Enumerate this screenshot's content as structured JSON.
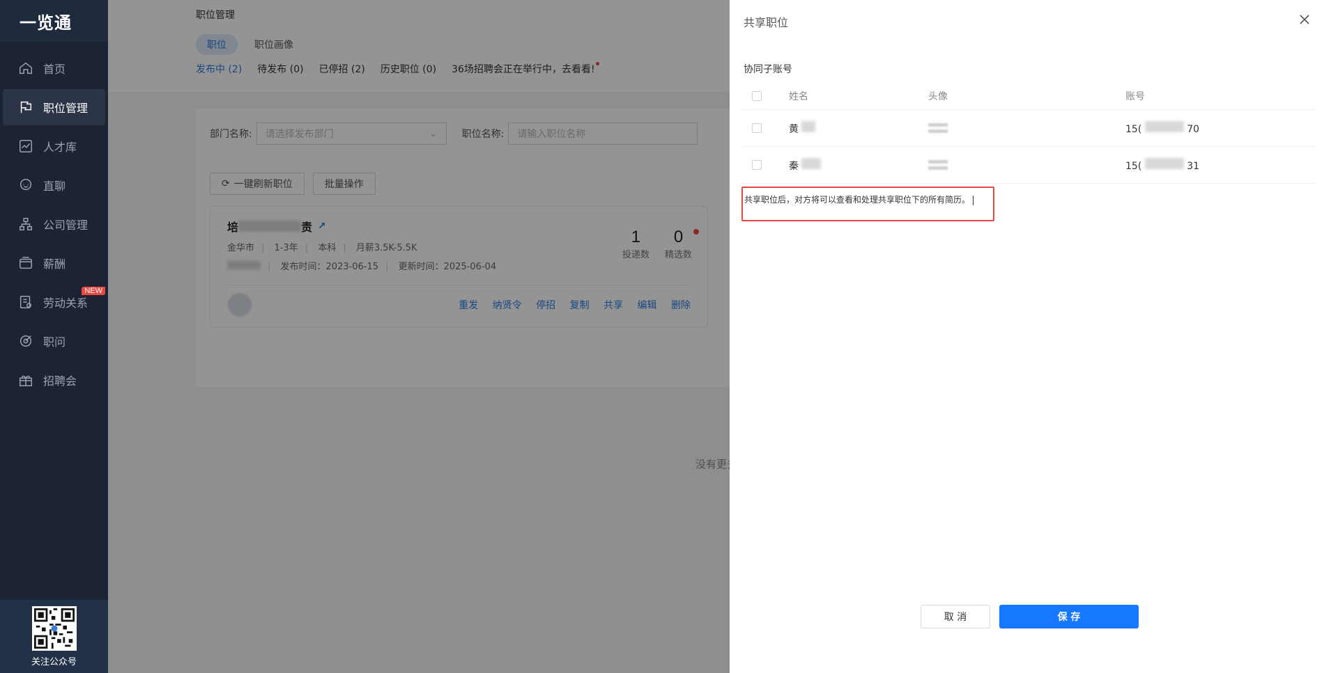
{
  "app": {
    "logo": "一览通"
  },
  "sidebar": {
    "items": [
      {
        "label": "首页",
        "icon": "home-icon"
      },
      {
        "label": "职位管理",
        "icon": "flag-icon"
      },
      {
        "label": "人才库",
        "icon": "chart-icon"
      },
      {
        "label": "直聊",
        "icon": "chat-icon"
      },
      {
        "label": "公司管理",
        "icon": "org-icon"
      },
      {
        "label": "薪酬",
        "icon": "wallet-icon"
      },
      {
        "label": "劳动关系",
        "icon": "contract-icon",
        "badge": "NEW"
      },
      {
        "label": "职问",
        "icon": "target-icon"
      },
      {
        "label": "招聘会",
        "icon": "gift-icon"
      }
    ],
    "qr_label": "关注公众号"
  },
  "page": {
    "title": "职位管理",
    "tabs": [
      "职位",
      "职位画像"
    ],
    "status_filters": [
      "发布中 (2)",
      "待发布 (0)",
      "已停招 (2)",
      "历史职位 (0)"
    ],
    "promo": "36场招聘会正在举行中，去看看!"
  },
  "filters": {
    "dept_label": "部门名称:",
    "dept_placeholder": "请选择发布部门",
    "job_label": "职位名称:",
    "job_placeholder": "请输入职位名称"
  },
  "toolbar": {
    "refresh_label": "一键刷新职位",
    "batch_label": "批量操作"
  },
  "job_card": {
    "title_prefix": "培",
    "title_suffix": "责",
    "meta": [
      "金华市",
      "1-3年",
      "本科",
      "月薪3.5K-5.5K"
    ],
    "publish_time": "发布时间：2023-06-15",
    "update_time": "更新时间：2025-06-04",
    "stats": [
      {
        "value": "1",
        "label": "投递数"
      },
      {
        "value": "0",
        "label": "精选数"
      }
    ],
    "actions": [
      "重发",
      "纳贤令",
      "停招",
      "复制",
      "共享",
      "编辑",
      "删除"
    ]
  },
  "no_more": "没有更多",
  "drawer": {
    "title": "共享职位",
    "section_label": "协同子账号",
    "columns": [
      "姓名",
      "头像",
      "账号"
    ],
    "rows": [
      {
        "name": "黄",
        "account_prefix": "15(",
        "account_suffix": "70"
      },
      {
        "name": "秦",
        "account_prefix": "15(",
        "account_suffix": "31"
      }
    ],
    "note": "共享职位后，对方将可以查看和处理共享职位下的所有简历。",
    "cancel_label": "取 消",
    "save_label": "保 存"
  },
  "colors": {
    "primary": "#1677ff",
    "sidebar_bg": "#1c2434",
    "highlight_border": "#e8483f"
  }
}
